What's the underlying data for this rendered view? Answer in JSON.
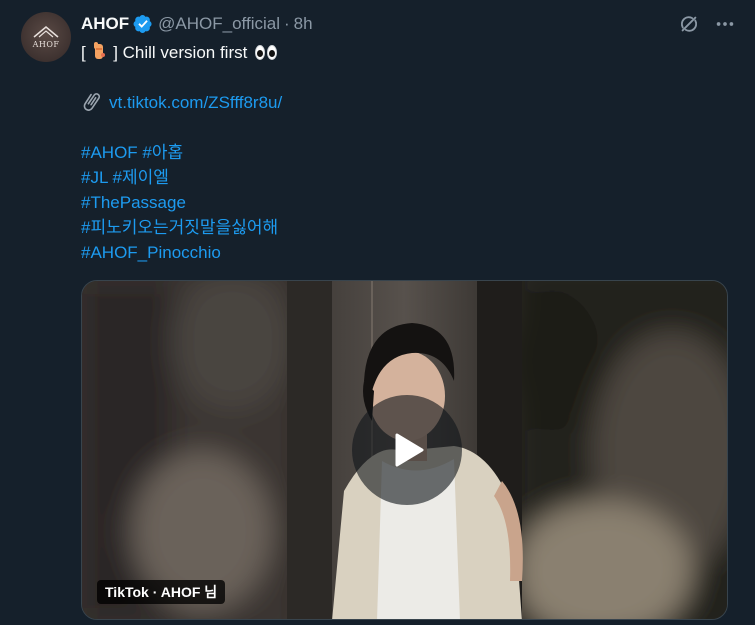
{
  "author": {
    "display_name": "AHOF",
    "handle": "@AHOF_official",
    "separator": "·",
    "time": "8h",
    "avatar_text": "AHOF",
    "verified": true
  },
  "tweet": {
    "line1_prefix": "[",
    "line1_suffix": "] Chill version first",
    "link": "vt.tiktok.com/ZSfff8r8u/",
    "hashtag_lines": [
      "#AHOF #아홉",
      "#JL #제이엘",
      "#ThePassage",
      "#피노키오는거짓말을싫어해",
      "#AHOF_Pinocchio"
    ]
  },
  "media": {
    "source_label": "TikTok · AHOF 님"
  },
  "colors": {
    "background": "#15202b",
    "link": "#1d9bf0",
    "verified": "#1d9bf0",
    "secondary_text": "#8b98a5"
  },
  "icons": {
    "grok": "grok-icon",
    "more": "more-icon",
    "play": "play-icon",
    "paperclip": "paperclip-icon",
    "verified": "verified-badge-icon"
  }
}
